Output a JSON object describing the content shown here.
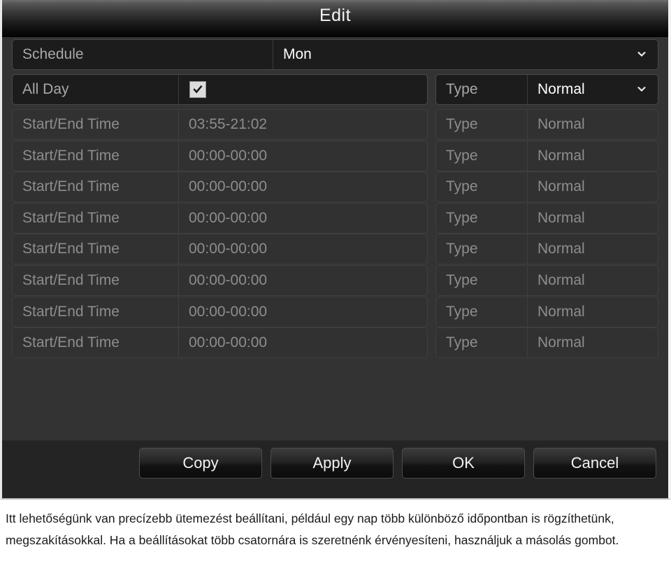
{
  "dialog": {
    "title": "Edit"
  },
  "schedule_row": {
    "label": "Schedule",
    "value": "Mon",
    "dropdown_icon": "chevron-down-icon"
  },
  "all_day_row": {
    "label": "All Day",
    "checked": true,
    "checkbox_icon": "checkmark-icon",
    "type_label": "Type",
    "type_value": "Normal",
    "dropdown_icon": "chevron-down-icon"
  },
  "time_rows": [
    {
      "label": "Start/End Time",
      "value": "03:55-21:02",
      "type_label": "Type",
      "type_value": "Normal"
    },
    {
      "label": "Start/End Time",
      "value": "00:00-00:00",
      "type_label": "Type",
      "type_value": "Normal"
    },
    {
      "label": "Start/End Time",
      "value": "00:00-00:00",
      "type_label": "Type",
      "type_value": "Normal"
    },
    {
      "label": "Start/End Time",
      "value": "00:00-00:00",
      "type_label": "Type",
      "type_value": "Normal"
    },
    {
      "label": "Start/End Time",
      "value": "00:00-00:00",
      "type_label": "Type",
      "type_value": "Normal"
    },
    {
      "label": "Start/End Time",
      "value": "00:00-00:00",
      "type_label": "Type",
      "type_value": "Normal"
    },
    {
      "label": "Start/End Time",
      "value": "00:00-00:00",
      "type_label": "Type",
      "type_value": "Normal"
    },
    {
      "label": "Start/End Time",
      "value": "00:00-00:00",
      "type_label": "Type",
      "type_value": "Normal"
    }
  ],
  "buttons": [
    {
      "label": "Copy",
      "name": "copy-button"
    },
    {
      "label": "Apply",
      "name": "apply-button"
    },
    {
      "label": "OK",
      "name": "ok-button"
    },
    {
      "label": "Cancel",
      "name": "cancel-button"
    }
  ],
  "caption": {
    "text": "Itt lehetőségünk van precízebb ütemezést beállítani, például egy nap több különböző időpontban is rögzíthetünk, megszakításokkal. Ha a beállításokat több csatornára is szeretnénk érvényesíteni, használjuk a másolás gombot."
  },
  "colors": {
    "dialog_background": "#333333",
    "row_disabled_background": "#313131",
    "row_active_background": "#1c1c1c",
    "footer_background": "#242424",
    "text_primary": "#ffffff",
    "text_muted": "#8d8d8d",
    "checkbox_fill": "#dcdcdc"
  }
}
